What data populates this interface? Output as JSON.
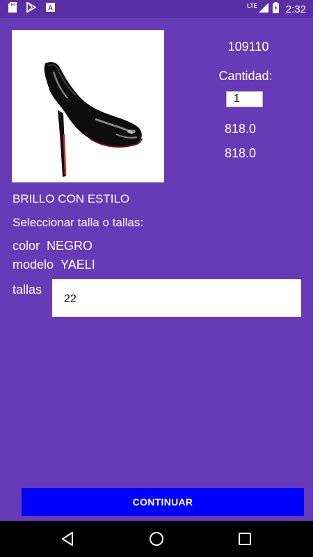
{
  "status_bar": {
    "time": "2:32",
    "network": "LTE",
    "icons": [
      "sd-card-icon",
      "play-store-icon",
      "font-a-icon",
      "lte-signal-icon",
      "battery-charging-icon"
    ]
  },
  "product": {
    "code": "109110",
    "quantity_label": "Cantidad:",
    "quantity_value": "1",
    "price": "818.0",
    "total": "818.0",
    "name": "BRILLO CON ESTILO",
    "select_sizes_label": "Seleccionar talla o tallas:",
    "color_label": "color",
    "color_value": "NEGRO",
    "model_label": "modelo",
    "model_value": "YAELI",
    "sizes_label": "tallas",
    "sizes_value": "22"
  },
  "actions": {
    "continue_label": "CONTINUAR"
  },
  "nav_bar": {
    "icons": [
      "back-icon",
      "home-icon",
      "recents-icon"
    ]
  },
  "colors": {
    "background": "#673ab7",
    "status_bar": "#5a2fa6",
    "button": "#0000ff"
  }
}
